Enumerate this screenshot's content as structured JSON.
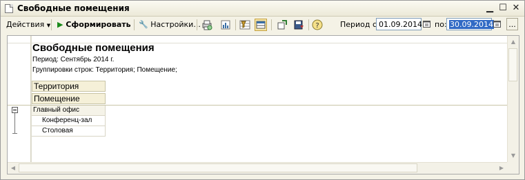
{
  "window": {
    "title": "Свободные помещения",
    "minimize_icon": "minimize-icon",
    "maximize_icon": "maximize-icon",
    "close_icon": "close-icon"
  },
  "toolbar": {
    "actions_label": "Действия",
    "generate_label": "Сформировать",
    "settings_label": "Настройки...",
    "period_from_label": "Период с:",
    "period_from_value": "01.09.2014",
    "period_to_label": "по:",
    "period_to_value": "30.09.2014",
    "more_label": "...",
    "icons": [
      "play-icon",
      "wrench-icon",
      "print-preview-icon",
      "chart-icon",
      "filter-icon",
      "table-view-icon",
      "load-settings-icon",
      "save-settings-icon",
      "help-icon",
      "calendar-icon"
    ]
  },
  "report": {
    "title": "Свободные помещения",
    "period_line": "Период: Сентябрь 2014 г.",
    "grouping_line": "Группировки строк: Территория; Помещение;",
    "header_1": "Территория",
    "header_2": "Помещение",
    "group_label": "Главный офис",
    "items": [
      "Конференц-зал",
      "Столовая"
    ]
  }
}
